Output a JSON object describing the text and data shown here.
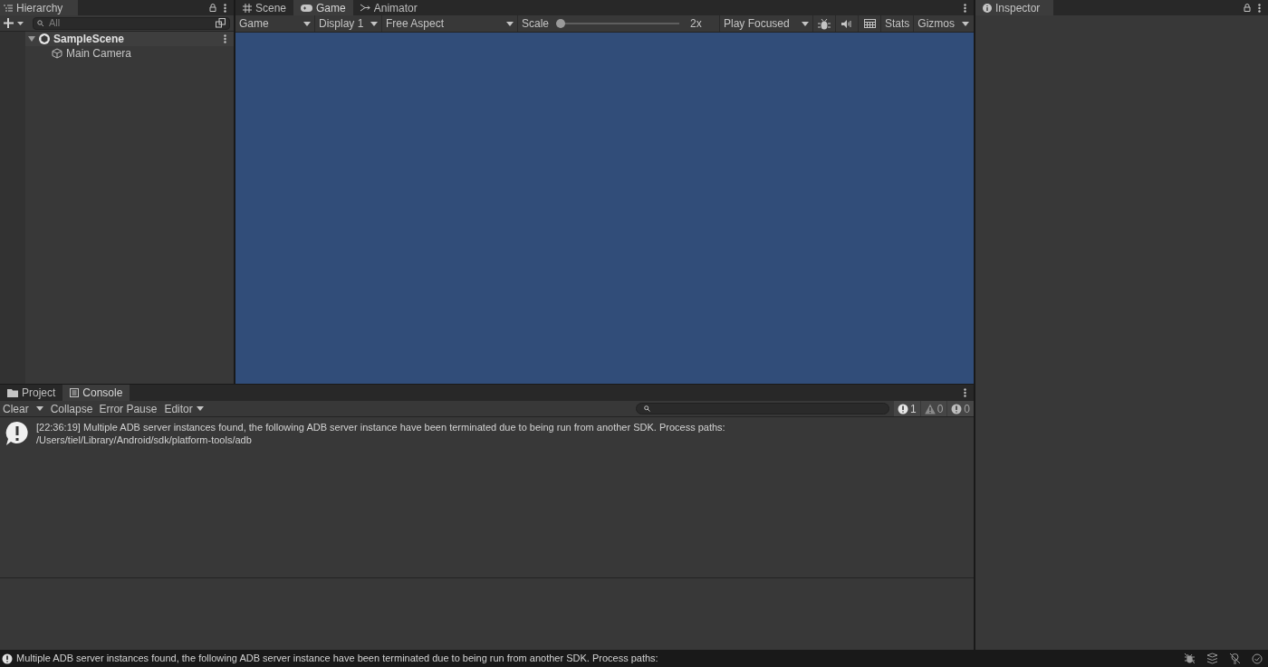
{
  "hierarchy": {
    "tab": "Hierarchy",
    "search_placeholder": "All",
    "items": [
      {
        "label": "SampleScene",
        "kind": "scene",
        "expanded": true,
        "children": [
          {
            "label": "Main Camera",
            "kind": "object"
          }
        ]
      }
    ]
  },
  "game": {
    "tabs": [
      {
        "label": "Scene",
        "kind": "scene",
        "selected": false
      },
      {
        "label": "Game",
        "kind": "game",
        "selected": true
      },
      {
        "label": "Animator",
        "kind": "animator",
        "selected": false
      }
    ],
    "toolbar": {
      "view": "Game",
      "display": "Display 1",
      "aspect": "Free Aspect",
      "scale_label": "Scale",
      "scale_slider": {
        "level": 0
      },
      "scale_value": "2x",
      "play_mode": "Play Focused",
      "stats": "Stats",
      "gizmos": "Gizmos"
    }
  },
  "inspector": {
    "tab": "Inspector"
  },
  "console": {
    "tabs": [
      {
        "label": "Project",
        "kind": "folder",
        "selected": false
      },
      {
        "label": "Console",
        "kind": "console",
        "selected": true
      }
    ],
    "buttons": [
      "Clear",
      "Collapse",
      "Error Pause"
    ],
    "editor_dropdown": "Editor",
    "counts": [
      {
        "kind": "log",
        "count": "1"
      },
      {
        "kind": "warning",
        "count": "0"
      },
      {
        "kind": "error",
        "count": "0"
      }
    ],
    "messages": [
      {
        "text": "[22:36:19] Multiple ADB server instances found, the following ADB server instance have been terminated due to being run from another SDK. Process paths:",
        "detail": "/Users/tiel/Library/Android/sdk/platform-tools/adb"
      }
    ]
  },
  "status_bar": {
    "text": "Multiple ADB server instances found, the following ADB server instance have been terminated due to being run from another SDK. Process paths:"
  }
}
